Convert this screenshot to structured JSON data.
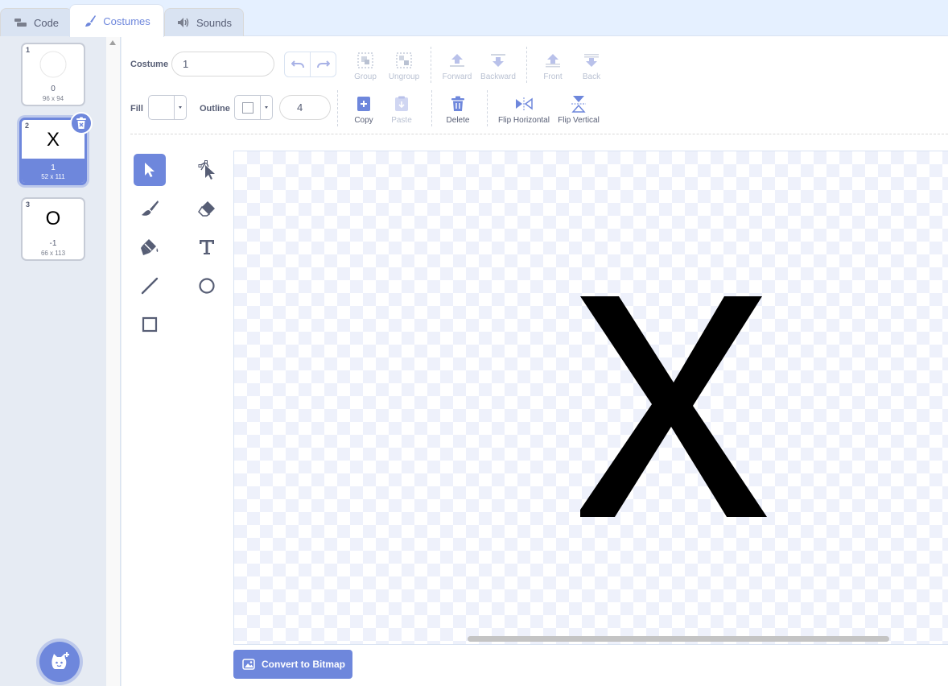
{
  "tabs": [
    {
      "label": "Code",
      "icon": "code-icon"
    },
    {
      "label": "Costumes",
      "icon": "brush-icon"
    },
    {
      "label": "Sounds",
      "icon": "speaker-icon"
    }
  ],
  "costumes": [
    {
      "number": "1",
      "thumb": "",
      "name": "0",
      "size": "96 x 94"
    },
    {
      "number": "2",
      "thumb": "X",
      "name": "1",
      "size": "52 x 111"
    },
    {
      "number": "3",
      "thumb": "O",
      "name": "-1",
      "size": "66 x 113"
    }
  ],
  "toolbar": {
    "costume_label": "Costume",
    "costume_name": "1",
    "group": "Group",
    "ungroup": "Ungroup",
    "forward": "Forward",
    "backward": "Backward",
    "front": "Front",
    "back": "Back",
    "fill_label": "Fill",
    "outline_label": "Outline",
    "outline_width": "4",
    "copy": "Copy",
    "paste": "Paste",
    "delete": "Delete",
    "flip_horizontal": "Flip Horizontal",
    "flip_vertical": "Flip Vertical"
  },
  "canvas": {
    "glyph": "X"
  },
  "convert_button": "Convert to Bitmap",
  "colors": {
    "accent": "#6e87dc",
    "text": "#575e75",
    "disabled": "#a8b2c7"
  }
}
